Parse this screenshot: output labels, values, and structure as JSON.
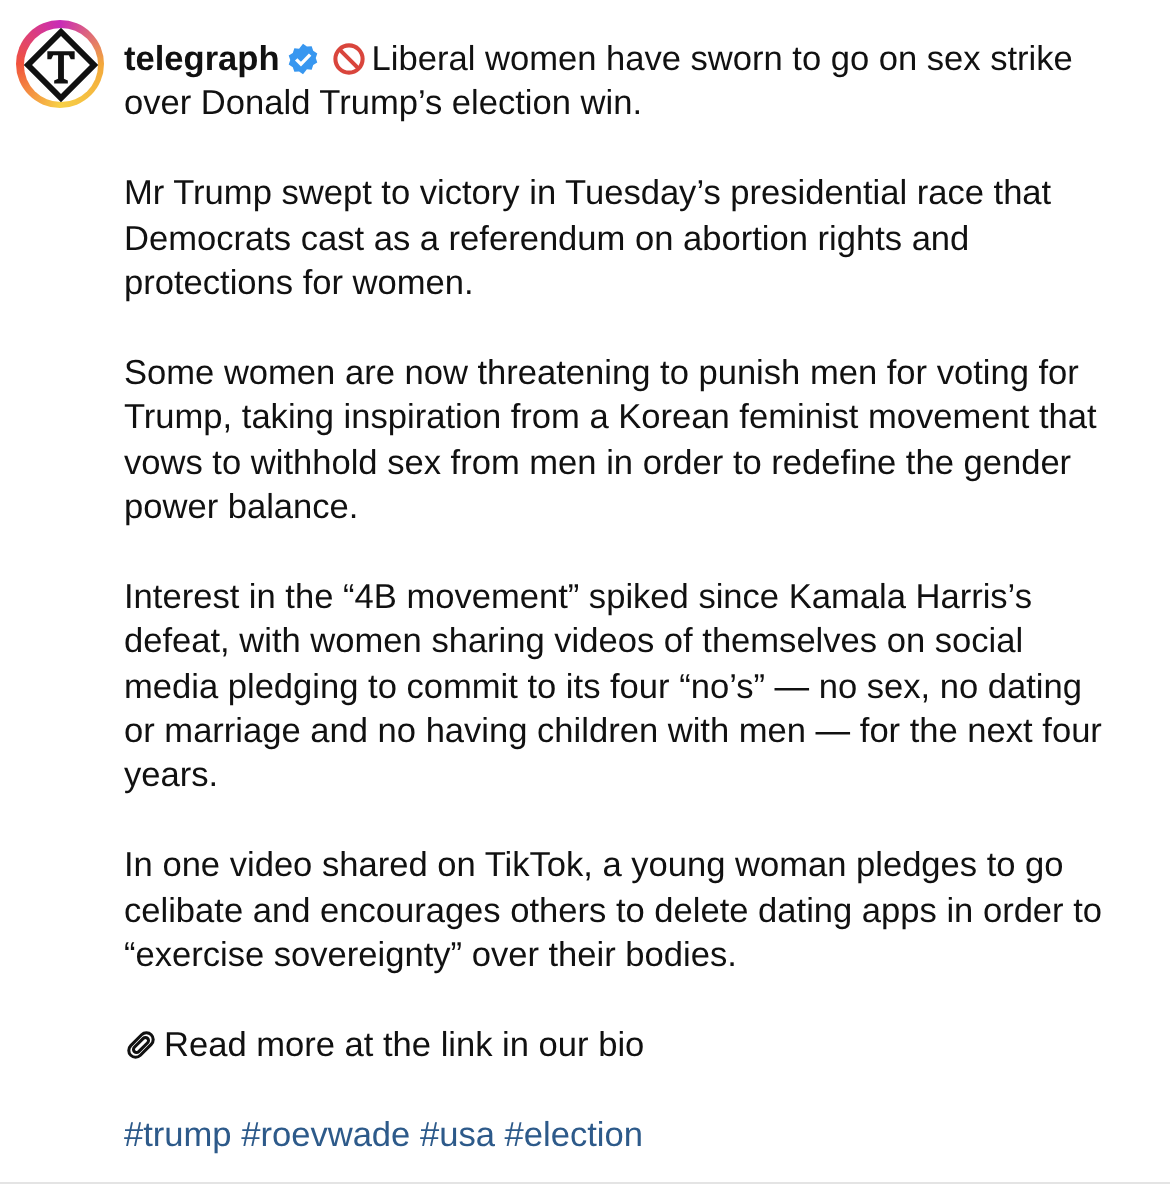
{
  "post": {
    "username": "telegraph",
    "verified": true,
    "headline_lines": [
      "Liberal women have sworn to go on sex strike",
      "over Donald Trump’s election win."
    ],
    "paragraphs": [
      "Mr Trump swept to victory in Tuesday’s presidential race that Democrats cast as a referendum on abortion rights and protections for women.",
      "Some women are now threatening to punish men for voting for Trump, taking inspiration from a Korean feminist movement that vows to withhold sex from men in order to redefine the gender power balance.",
      "Interest in the “4B movement” spiked since Kamala Harris’s defeat, with women sharing videos of themselves on social media pledging to commit to its four “no’s” — no sex, no dating or marriage and no having children with men — for the next four years.",
      "In one video shared on TikTok, a young woman pledges to go celibate and encourages others to delete dating apps in order to “exercise sovereignty” over their bodies."
    ],
    "link_note": "Read more at the link in our bio",
    "hashtags": [
      "#trump",
      "#roevwade",
      "#usa",
      "#election"
    ]
  }
}
